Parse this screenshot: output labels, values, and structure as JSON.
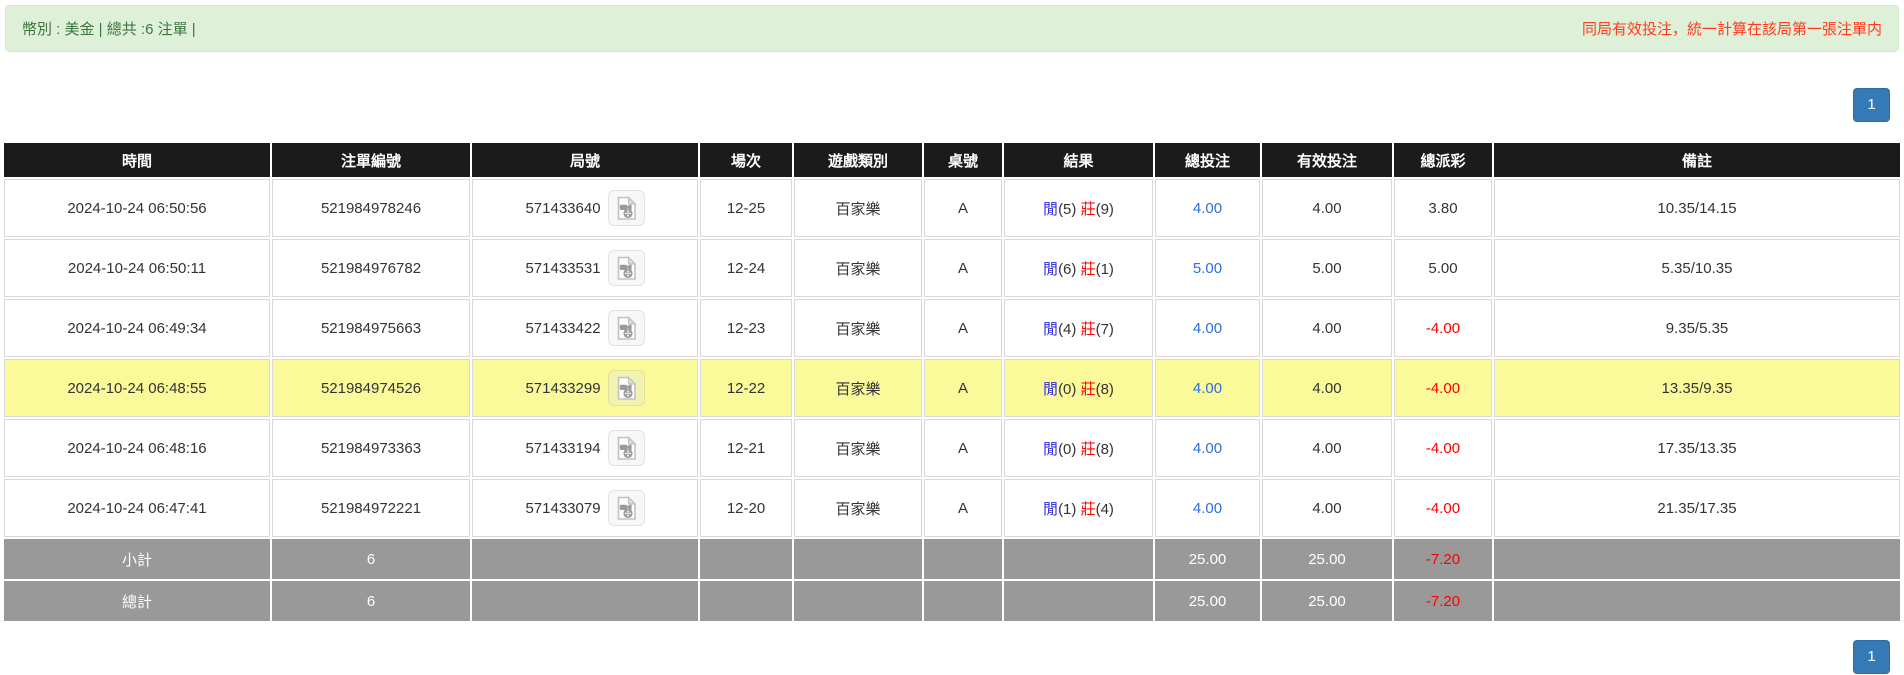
{
  "meta_bar": {
    "left_text": "幣別 : 美金 | 總共 :6 注單 |",
    "right_text": "同局有效投注，統一計算在該局第一張注單内"
  },
  "pagination": {
    "page_label": "1"
  },
  "icons": {
    "round_cell_icon": "video-file-icon"
  },
  "colors": {
    "alert_bg": "#dff0d8",
    "alert_border": "#d6e9c6",
    "alert_text": "#3c763d",
    "warning_text": "#ff3b1e",
    "header_bg": "#1b1b1b",
    "header_text": "#ffffff",
    "footer_bg": "#999999",
    "highlight_row_bg": "#fafa9b",
    "player_blue": "#2a2ae0",
    "banker_red": "#ff0000",
    "amount_link_blue": "#2f6fdb",
    "negative_red": "#ff0000",
    "pagination_blue": "#337ab7"
  },
  "table": {
    "columns": [
      "時間",
      "注單編號",
      "局號",
      "場次",
      "遊戲類別",
      "桌號",
      "結果",
      "總投注",
      "有效投注",
      "總派彩",
      "備註"
    ],
    "rows": [
      {
        "time": "2024-10-24 06:50:56",
        "bet_id": "521984978246",
        "round_id": "571433640",
        "session": "12-25",
        "game_type": "百家樂",
        "table_no": "A",
        "result_player_label": "閒",
        "result_player_score": "(5)",
        "result_banker_label": "莊",
        "result_banker_score": "(9)",
        "total_bet": "4.00",
        "valid_bet": "4.00",
        "payout": "3.80",
        "payout_negative": false,
        "remark": "10.35/14.15",
        "highlighted": false
      },
      {
        "time": "2024-10-24 06:50:11",
        "bet_id": "521984976782",
        "round_id": "571433531",
        "session": "12-24",
        "game_type": "百家樂",
        "table_no": "A",
        "result_player_label": "閒",
        "result_player_score": "(6)",
        "result_banker_label": "莊",
        "result_banker_score": "(1)",
        "total_bet": "5.00",
        "valid_bet": "5.00",
        "payout": "5.00",
        "payout_negative": false,
        "remark": "5.35/10.35",
        "highlighted": false
      },
      {
        "time": "2024-10-24 06:49:34",
        "bet_id": "521984975663",
        "round_id": "571433422",
        "session": "12-23",
        "game_type": "百家樂",
        "table_no": "A",
        "result_player_label": "閒",
        "result_player_score": "(4)",
        "result_banker_label": "莊",
        "result_banker_score": "(7)",
        "total_bet": "4.00",
        "valid_bet": "4.00",
        "payout": "-4.00",
        "payout_negative": true,
        "remark": "9.35/5.35",
        "highlighted": false
      },
      {
        "time": "2024-10-24 06:48:55",
        "bet_id": "521984974526",
        "round_id": "571433299",
        "session": "12-22",
        "game_type": "百家樂",
        "table_no": "A",
        "result_player_label": "閒",
        "result_player_score": "(0)",
        "result_banker_label": "莊",
        "result_banker_score": "(8)",
        "total_bet": "4.00",
        "valid_bet": "4.00",
        "payout": "-4.00",
        "payout_negative": true,
        "remark": "13.35/9.35",
        "highlighted": true
      },
      {
        "time": "2024-10-24 06:48:16",
        "bet_id": "521984973363",
        "round_id": "571433194",
        "session": "12-21",
        "game_type": "百家樂",
        "table_no": "A",
        "result_player_label": "閒",
        "result_player_score": "(0)",
        "result_banker_label": "莊",
        "result_banker_score": "(8)",
        "total_bet": "4.00",
        "valid_bet": "4.00",
        "payout": "-4.00",
        "payout_negative": true,
        "remark": "17.35/13.35",
        "highlighted": false
      },
      {
        "time": "2024-10-24 06:47:41",
        "bet_id": "521984972221",
        "round_id": "571433079",
        "session": "12-20",
        "game_type": "百家樂",
        "table_no": "A",
        "result_player_label": "閒",
        "result_player_score": "(1)",
        "result_banker_label": "莊",
        "result_banker_score": "(4)",
        "total_bet": "4.00",
        "valid_bet": "4.00",
        "payout": "-4.00",
        "payout_negative": true,
        "remark": "21.35/17.35",
        "highlighted": false
      }
    ],
    "footer": [
      {
        "label": "小計",
        "count": "6",
        "total_bet": "25.00",
        "valid_bet": "25.00",
        "payout": "-7.20",
        "payout_negative": true
      },
      {
        "label": "總計",
        "count": "6",
        "total_bet": "25.00",
        "valid_bet": "25.00",
        "payout": "-7.20",
        "payout_negative": true
      }
    ]
  }
}
